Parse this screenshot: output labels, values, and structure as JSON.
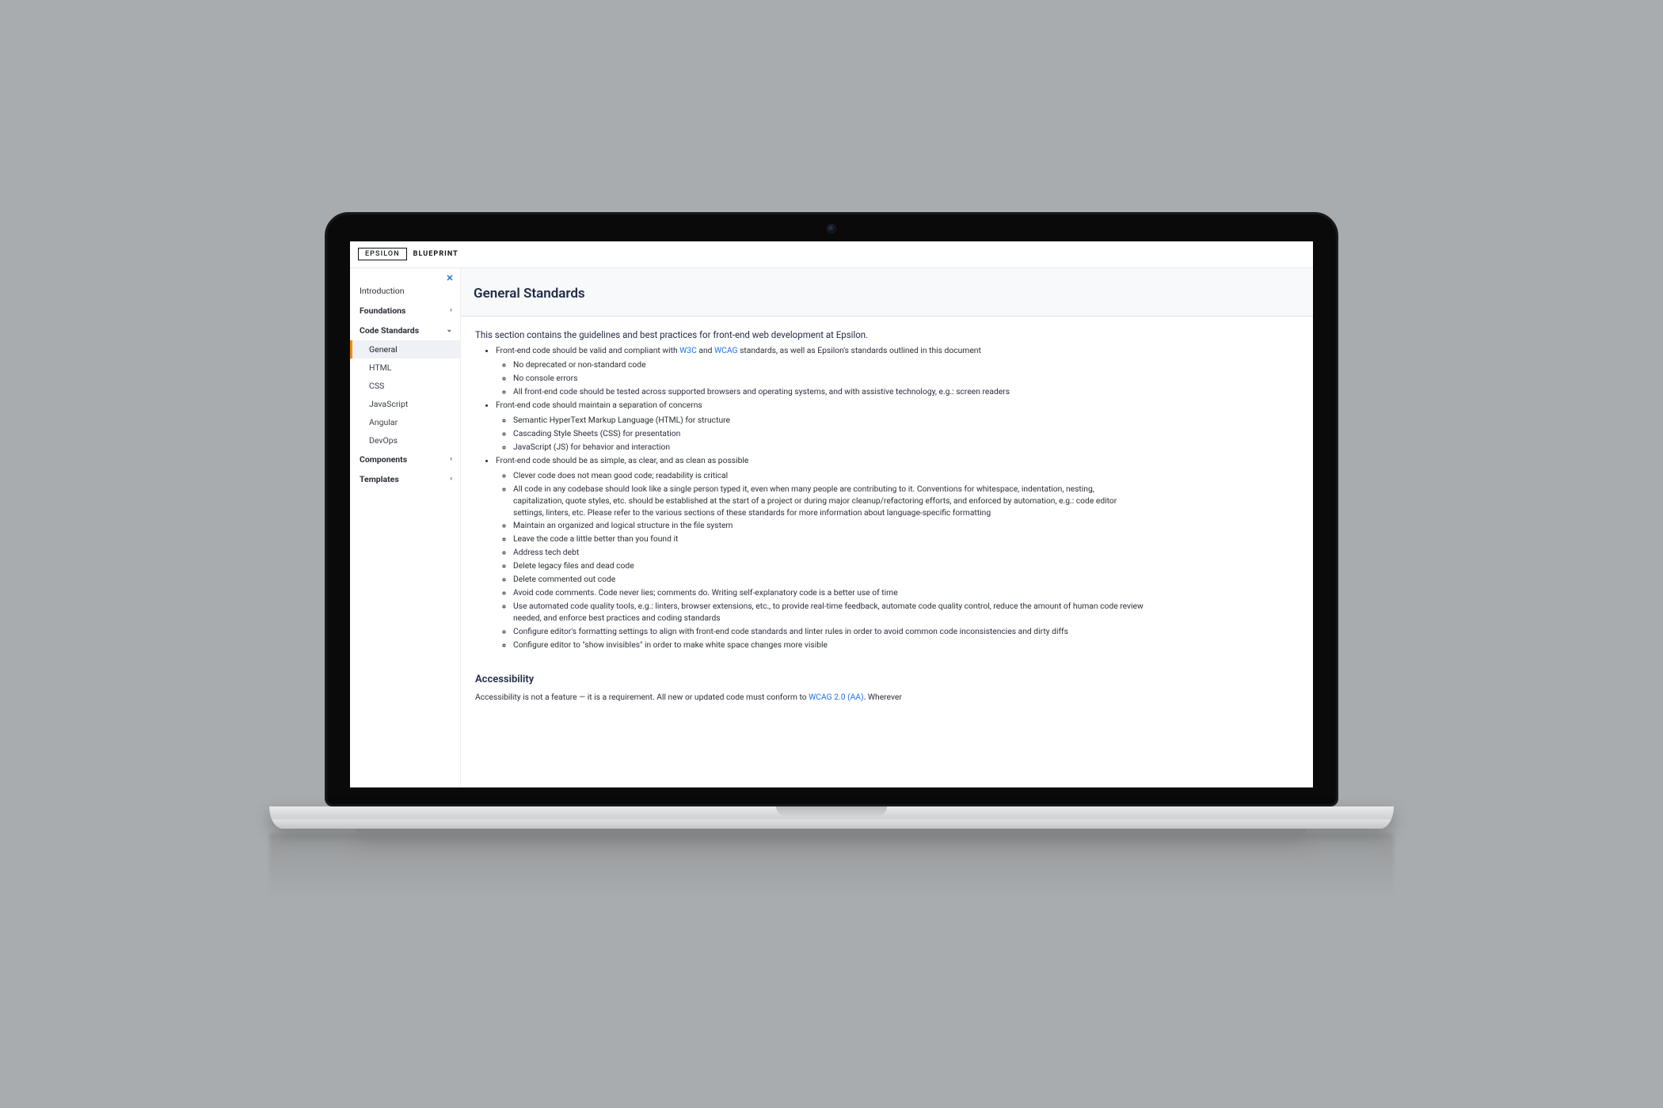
{
  "brand": {
    "badge": "EPSILON",
    "sub": "BLUEPRINT"
  },
  "nav": {
    "introduction": "Introduction",
    "foundations": "Foundations",
    "codeStandards": "Code Standards",
    "components": "Components",
    "templates": "Templates",
    "sub": {
      "general": "General",
      "html": "HTML",
      "css": "CSS",
      "javascript": "JavaScript",
      "angular": "Angular",
      "devops": "DevOps"
    }
  },
  "page": {
    "title": "General Standards",
    "intro": "This section contains the guidelines and best practices for front-end web development at Epsilon.",
    "bullets": {
      "b1_pre": "Front-end code should be valid and compliant with ",
      "b1_w3c": "W3C",
      "b1_and": " and ",
      "b1_wcag": "WCAG",
      "b1_post": " standards, as well as Epsilon's standards outlined in this document",
      "b1_sub": {
        "s1": "No deprecated or non-standard code",
        "s2": "No console errors",
        "s3": "All front-end code should be tested across supported browsers and operating systems, and with assistive technology, e.g.: screen readers"
      },
      "b2": "Front-end code should maintain a separation of concerns",
      "b2_sub": {
        "s1": "Semantic HyperText Markup Language (HTML) for structure",
        "s2": "Cascading Style Sheets (CSS) for presentation",
        "s3": "JavaScript (JS) for behavior and interaction"
      },
      "b3": "Front-end code should be as simple, as clear, and as clean as possible",
      "b3_sub": {
        "s1": "Clever code does not mean good code; readability is critical",
        "s2": "All code in any codebase should look like a single person typed it, even when many people are contributing to it. Conventions for whitespace, indentation, nesting, capitalization, quote styles, etc. should be established at the start of a project or during major cleanup/refactoring efforts, and enforced by automation, e.g.: code editor settings, linters, etc. Please refer to the various sections of these standards for more information about language-specific formatting",
        "s3": "Maintain an organized and logical structure in the file system",
        "s4": "Leave the code a little better than you found it",
        "s5": "Address tech debt",
        "s6": "Delete legacy files and dead code",
        "s7": "Delete commented out code",
        "s8": "Avoid code comments. Code never lies; comments do. Writing self-explanatory code is a better use of time",
        "s9": "Use automated code quality tools, e.g.: linters, browser extensions, etc., to provide real-time feedback, automate code quality control, reduce the amount of human code review needed, and enforce best practices and coding standards",
        "s10": "Configure editor's formatting settings to align with front-end code standards and linter rules in order to avoid common code inconsistencies and dirty diffs",
        "s11": "Configure editor to \"show invisibles\" in order to make white space changes more visible"
      }
    },
    "a11y": {
      "heading": "Accessibility",
      "pre": "Accessibility is not a feature — it is a requirement. All new or updated code must conform to ",
      "link": "WCAG 2.0 (AA)",
      "post": ". Wherever"
    }
  }
}
